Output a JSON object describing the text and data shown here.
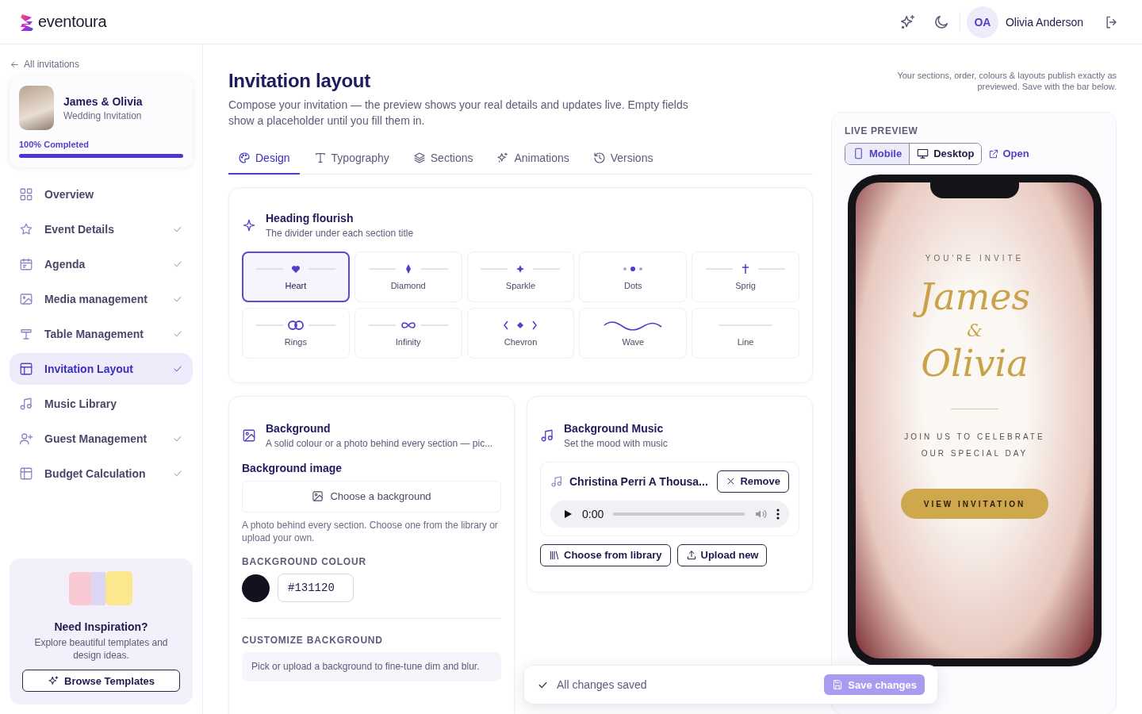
{
  "brand": {
    "name": "eventoura"
  },
  "header": {
    "avatar_initials": "OA",
    "user_name": "Olivia Anderson"
  },
  "sidebar": {
    "back_link": "All invitations",
    "event": {
      "title": "James & Olivia",
      "subtitle": "Wedding Invitation",
      "progress_label": "100% Completed",
      "level": 1
    },
    "items": [
      {
        "label": "Overview",
        "completed": false,
        "selected": false
      },
      {
        "label": "Event Details",
        "completed": true,
        "selected": false
      },
      {
        "label": "Agenda",
        "completed": true,
        "selected": false
      },
      {
        "label": "Media management",
        "completed": true,
        "selected": false
      },
      {
        "label": "Table Management",
        "completed": true,
        "selected": false
      },
      {
        "label": "Invitation Layout",
        "completed": true,
        "selected": true
      },
      {
        "label": "Music Library",
        "completed": false,
        "selected": false
      },
      {
        "label": "Guest Management",
        "completed": true,
        "selected": false
      },
      {
        "label": "Budget Calculation",
        "completed": true,
        "selected": false
      }
    ],
    "inspiration": {
      "title": "Need Inspiration?",
      "text": "Explore beautiful templates and design ideas.",
      "button": "Browse Templates"
    }
  },
  "page": {
    "title": "Invitation layout",
    "description": "Compose your invitation — the preview shows your real details and updates live. Empty fields show a placeholder until you fill them in.",
    "note": "Your sections, order, colours & layouts publish exactly as previewed. Save with the bar below."
  },
  "tabs": [
    {
      "label": "Design",
      "selected": true
    },
    {
      "label": "Typography",
      "selected": false
    },
    {
      "label": "Sections",
      "selected": false
    },
    {
      "label": "Animations",
      "selected": false
    },
    {
      "label": "Versions",
      "selected": false
    }
  ],
  "heading_flourish": {
    "title": "Heading flourish",
    "subtitle": "The divider under each section title",
    "options": [
      {
        "label": "Heart",
        "kind": "heart",
        "selected": true
      },
      {
        "label": "Diamond",
        "kind": "diamond",
        "selected": false
      },
      {
        "label": "Sparkle",
        "kind": "sparkle",
        "selected": false
      },
      {
        "label": "Dots",
        "kind": "dots",
        "selected": false
      },
      {
        "label": "Sprig",
        "kind": "sprig",
        "selected": false
      },
      {
        "label": "Rings",
        "kind": "rings",
        "selected": false
      },
      {
        "label": "Infinity",
        "kind": "infinity",
        "selected": false
      },
      {
        "label": "Chevron",
        "kind": "chevron",
        "selected": false
      },
      {
        "label": "Wave",
        "kind": "wave",
        "selected": false
      },
      {
        "label": "Line",
        "kind": "line",
        "selected": false
      }
    ]
  },
  "background": {
    "title": "Background",
    "subtitle": "A solid colour or a photo behind every section — pic...",
    "image_label": "Background image",
    "choose_button": "Choose a background",
    "image_help": "A photo behind every section. Choose one from the library or upload your own.",
    "colour_label": "BACKGROUND COLOUR",
    "colour_value": "#131120",
    "color": "#131120",
    "customize_label": "CUSTOMIZE BACKGROUND",
    "customize_text": "Pick or upload a background to fine-tune dim and blur."
  },
  "music": {
    "title": "Background Music",
    "subtitle": "Set the mood with music",
    "track": "Christina Perri A Thousa...",
    "remove_button": "Remove",
    "time": "0:00",
    "library_button": "Choose from library",
    "upload_button": "Upload new"
  },
  "preview": {
    "label": "LIVE PREVIEW",
    "devices": [
      {
        "label": "Mobile",
        "selected": true
      },
      {
        "label": "Desktop",
        "selected": false
      }
    ],
    "open_link": "Open",
    "invite": {
      "kicker": "YOU'RE INVITE",
      "name_1": "James",
      "ampersand": "&",
      "name_2": "Olivia",
      "message": "JOIN US TO CELEBRATE OUR SPECIAL DAY",
      "button": "VIEW INVITATION"
    }
  },
  "save_bar": {
    "status": "All changes saved",
    "button": "Save changes",
    "disabled": true
  }
}
